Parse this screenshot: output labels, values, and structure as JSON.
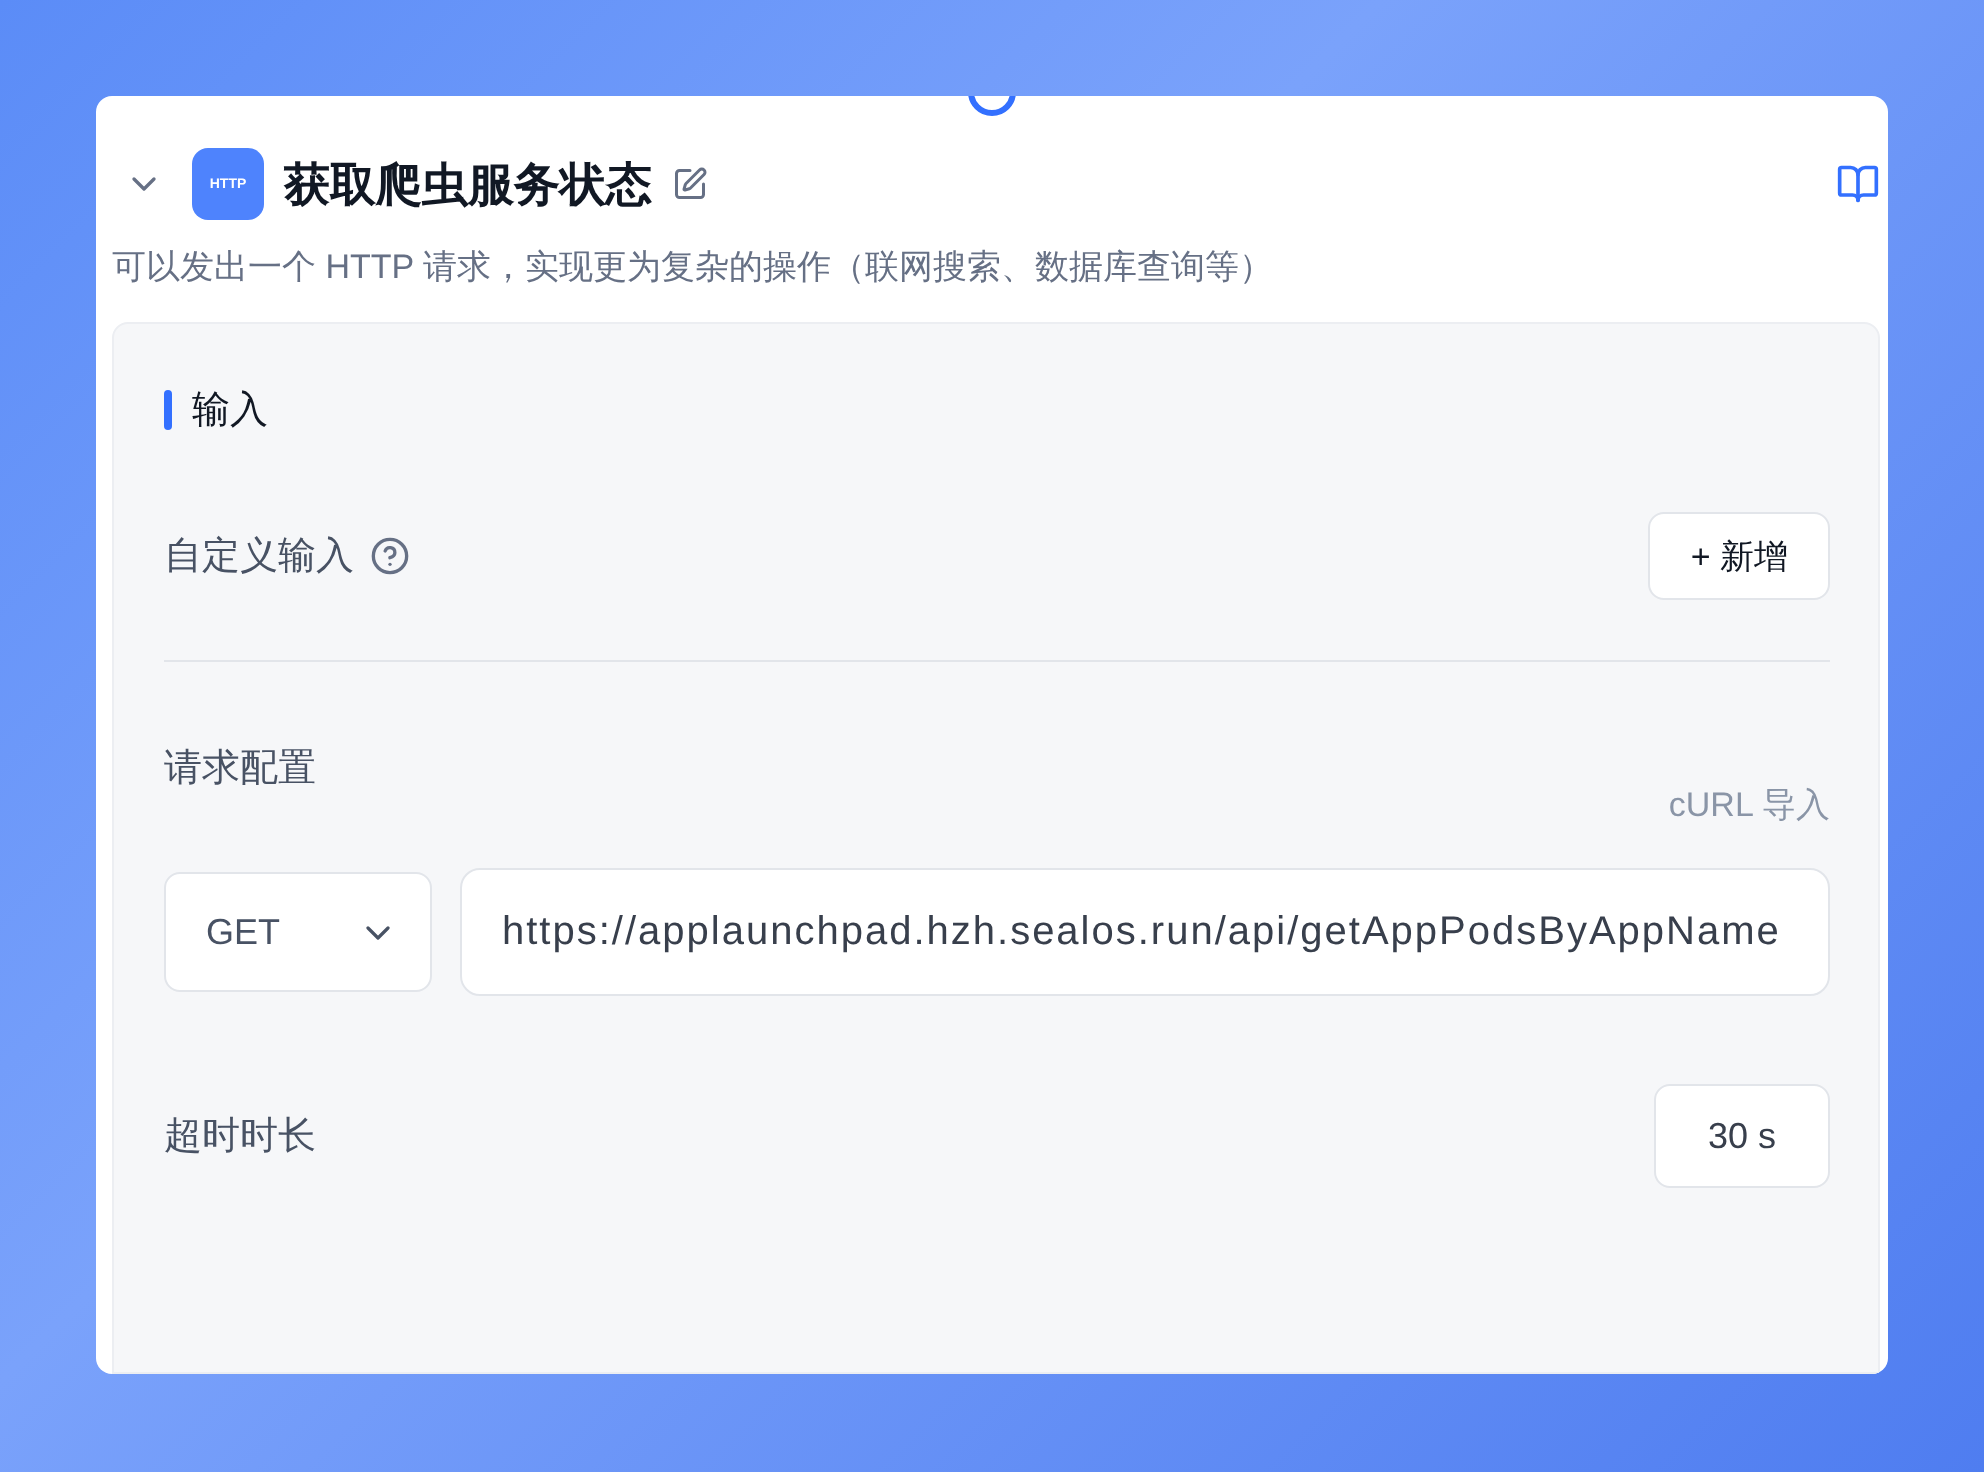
{
  "node": {
    "title": "获取爬虫服务状态",
    "icon_label": "HTTP",
    "expanded": true,
    "description": "可以发出一个 HTTP 请求，实现更为复杂的操作（联网搜索、数据库查询等）"
  },
  "section": {
    "title": "输入"
  },
  "custom_input": {
    "label": "自定义输入",
    "add_button": "+ 新增"
  },
  "request": {
    "label": "请求配置",
    "import_link": "cURL 导入",
    "method": "GET",
    "url": "https://applaunchpad.hzh.sealos.run/api/getAppPodsByAppName"
  },
  "timeout": {
    "label": "超时时长",
    "value": "30 s"
  }
}
